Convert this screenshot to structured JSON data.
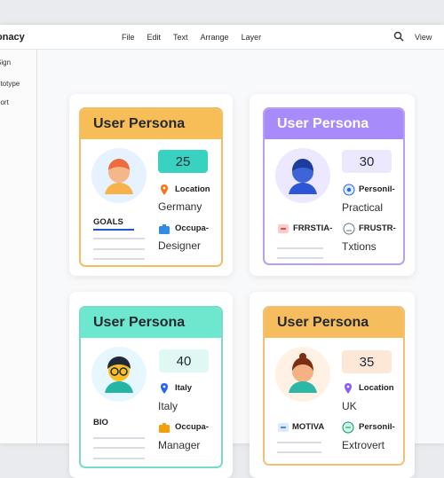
{
  "app": {
    "title": "onacy"
  },
  "menu": [
    "File",
    "Edit",
    "Text",
    "Arrange",
    "Layer"
  ],
  "toolbar": {
    "view_label": "View",
    "search_icon": "search-icon"
  },
  "sidebar": {
    "items": [
      "Sign",
      "ototype",
      "port"
    ]
  },
  "cards": [
    {
      "header": "User Persona",
      "number": "25",
      "row1_label": "Location",
      "row1_value": "Germany",
      "row2_label": "Occupa-",
      "row2_value": "Designer",
      "section_label": "GOALS"
    },
    {
      "header": "User Persona",
      "number": "30",
      "row1_label": "Personil-",
      "row1_value": "Practical",
      "row2_label": "FRUSTR-",
      "row2_value": "Txtions",
      "section_label": "FRRSTIA-"
    },
    {
      "header": "User Persona",
      "number": "40",
      "row1_label": "Italy",
      "row1_value": "Italy",
      "row2_label": "Occupa-",
      "row2_value": "Manager",
      "section_label": "BIO"
    },
    {
      "header": "User Persona",
      "number": "35",
      "row1_label": "Location",
      "row1_value": "UK",
      "row2_label": "Personil-",
      "row2_value": "Extrovert",
      "section_label": "MOTIVA"
    }
  ],
  "colors": {
    "orange": "#f2be63",
    "purple": "#b59cf3",
    "teal": "#79ddca",
    "peach": "#f6c27a"
  }
}
